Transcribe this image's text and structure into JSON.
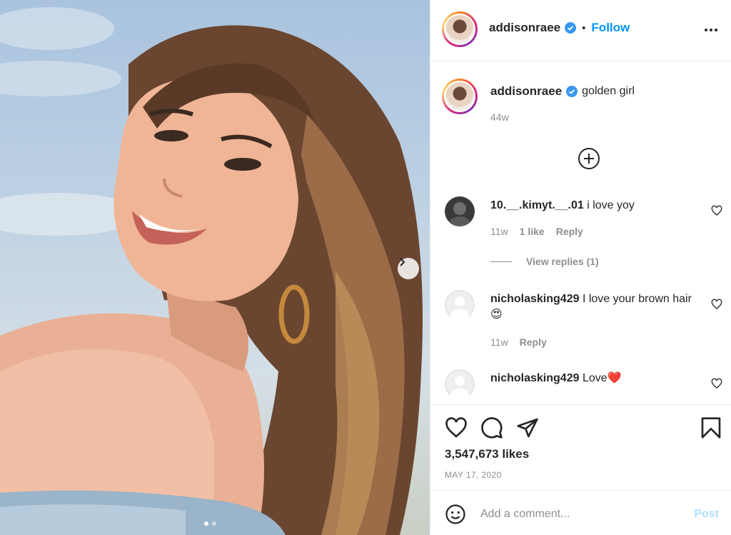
{
  "post": {
    "username": "addisonraee",
    "follow_label": "Follow",
    "dot_separator": "•",
    "more_icon": "more-horizontal-icon",
    "caption": "golden girl",
    "caption_age": "44w",
    "likes": "3,547,673 likes",
    "date": "MAY 17, 2020"
  },
  "comments": [
    {
      "username": "10.__.kimyt.__.01",
      "text": "i love yoy",
      "age": "11w",
      "likes": "1 like",
      "reply": "Reply",
      "view_replies": "View replies (1)"
    },
    {
      "username": "nicholasking429",
      "text": "I love your brown hair 😍",
      "age": "11w",
      "reply": "Reply"
    },
    {
      "username": "nicholasking429",
      "text": "Love❤️"
    }
  ],
  "composer": {
    "placeholder": "Add a comment...",
    "post_label": "Post"
  },
  "carousel": {
    "total": 2,
    "active": 1
  },
  "colors": {
    "accent": "#0095f6",
    "verified": "#3897f0",
    "text": "#262626",
    "muted": "#8e8e8e"
  }
}
